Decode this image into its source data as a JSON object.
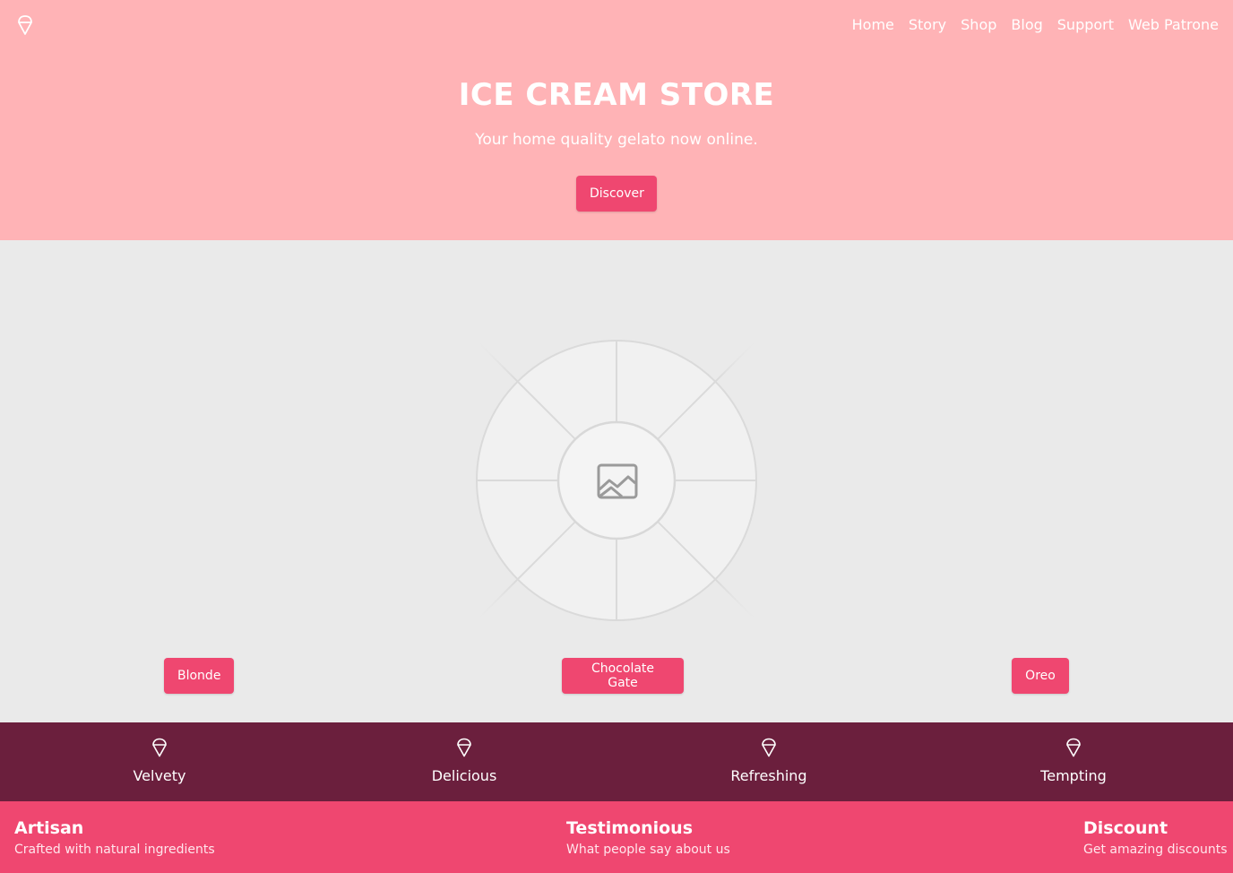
{
  "header": {
    "logo_icon": "ice-cream-cone-icon",
    "nav": [
      "Home",
      "Story",
      "Shop",
      "Blog",
      "Support",
      "Web Patrone"
    ]
  },
  "hero": {
    "title": "ICE CREAM STORE",
    "subtitle": "Your home quality gelato now online.",
    "cta": "Discover"
  },
  "products": {
    "image_icon": "image-placeholder-icon",
    "items": [
      "Blonde",
      "Chocolate Gate",
      "Oreo"
    ]
  },
  "features": [
    {
      "icon": "ice-cream-cone-icon",
      "label": "Velvety"
    },
    {
      "icon": "ice-cream-cone-icon",
      "label": "Delicious"
    },
    {
      "icon": "ice-cream-cone-icon",
      "label": "Refreshing"
    },
    {
      "icon": "ice-cream-cone-icon",
      "label": "Tempting"
    }
  ],
  "footer": [
    {
      "title": "Artisan",
      "text": "Crafted with natural ingredients"
    },
    {
      "title": "Testimonious",
      "text": "What people say about us"
    },
    {
      "title": "Discount",
      "text": "Get amazing discounts"
    }
  ],
  "colors": {
    "hero_bg": "#ffb3b6",
    "accent": "#ef4770",
    "features_bg": "#6b1f3d",
    "content_bg": "#eaeaea",
    "text_light": "#ffffff"
  }
}
